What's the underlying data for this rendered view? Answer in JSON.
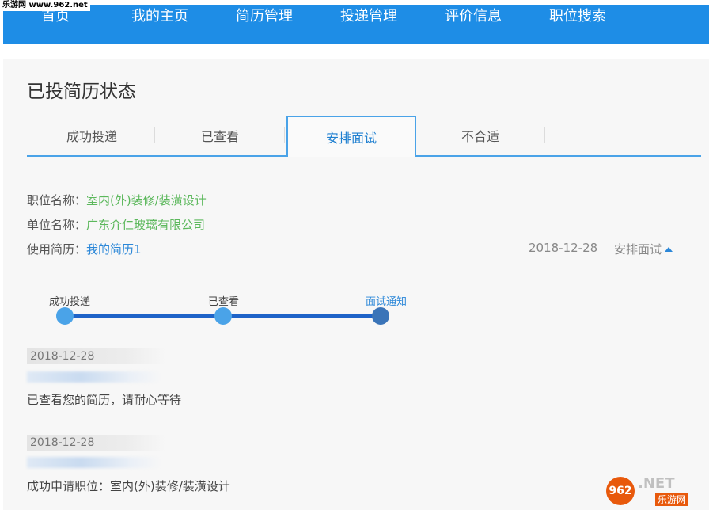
{
  "watermark_top": "乐游网 www.962.net",
  "nav": [
    "首页",
    "我的主页",
    "简历管理",
    "投递管理",
    "评价信息",
    "职位搜索"
  ],
  "panel_title": "已投简历状态",
  "tabs": [
    "成功投递",
    "已查看",
    "安排面试",
    "不合适"
  ],
  "info": {
    "position_label": "职位名称：",
    "position_value": "室内(外)装修/装潢设计",
    "company_label": "单位名称：",
    "company_value": "广东介仁玻璃有限公司",
    "resume_label": "使用简历：",
    "resume_value": "我的简历1"
  },
  "status": {
    "date": "2018-12-28",
    "text": "安排面试"
  },
  "steps": [
    "成功投递",
    "已查看",
    "面试通知"
  ],
  "logs": [
    {
      "date": "2018-12-28",
      "text": "已查看您的简历，请耐心等待"
    },
    {
      "date": "2018-12-28",
      "text": "成功申请职位：室内(外)装修/装潢设计"
    }
  ],
  "watermark_br": {
    "logo": "962",
    "net": ".NET",
    "sub": "乐游网"
  },
  "colors": {
    "nav_bg": "#1e8de6",
    "accent": "#4aa3e8",
    "progress": "#1e63c8",
    "green_link": "#5cb85c"
  }
}
